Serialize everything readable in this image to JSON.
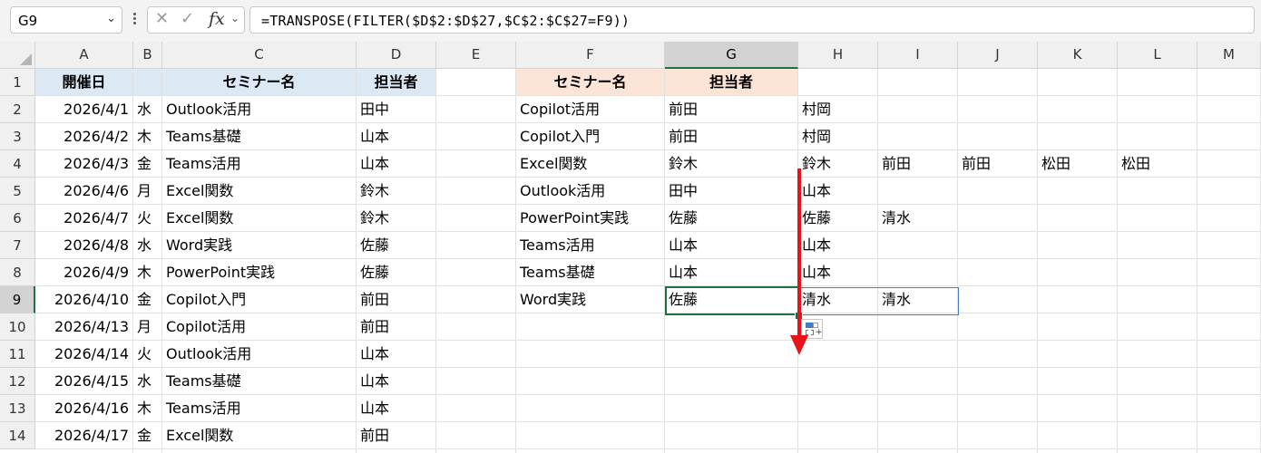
{
  "name_box": {
    "value": "G9"
  },
  "formula_bar": {
    "formula": "=TRANSPOSE(FILTER($D$2:$D$27,$C$2:$C$27=F9))",
    "cancel_icon": "close-icon",
    "enter_icon": "checkmark-icon",
    "function_icon": "fx"
  },
  "columns": [
    "A",
    "B",
    "C",
    "D",
    "E",
    "F",
    "G",
    "H",
    "I",
    "J",
    "K",
    "L",
    "M"
  ],
  "selected_column": "G",
  "selected_row": "9",
  "rows": [
    "1",
    "2",
    "3",
    "4",
    "5",
    "6",
    "7",
    "8",
    "9",
    "10",
    "11",
    "12",
    "13",
    "14"
  ],
  "table1": {
    "headers": {
      "date": "開催日",
      "seminar": "セミナー名",
      "person": "担当者"
    },
    "rows": [
      {
        "date": "2026/4/1",
        "dow": "水",
        "seminar": "Outlook活用",
        "person": "田中"
      },
      {
        "date": "2026/4/2",
        "dow": "木",
        "seminar": "Teams基礎",
        "person": "山本"
      },
      {
        "date": "2026/4/3",
        "dow": "金",
        "seminar": "Teams活用",
        "person": "山本"
      },
      {
        "date": "2026/4/6",
        "dow": "月",
        "seminar": "Excel関数",
        "person": "鈴木"
      },
      {
        "date": "2026/4/7",
        "dow": "火",
        "seminar": "Excel関数",
        "person": "鈴木"
      },
      {
        "date": "2026/4/8",
        "dow": "水",
        "seminar": "Word実践",
        "person": "佐藤"
      },
      {
        "date": "2026/4/9",
        "dow": "木",
        "seminar": "PowerPoint実践",
        "person": "佐藤"
      },
      {
        "date": "2026/4/10",
        "dow": "金",
        "seminar": "Copilot入門",
        "person": "前田"
      },
      {
        "date": "2026/4/13",
        "dow": "月",
        "seminar": "Copilot活用",
        "person": "前田"
      },
      {
        "date": "2026/4/14",
        "dow": "火",
        "seminar": "Outlook活用",
        "person": "山本"
      },
      {
        "date": "2026/4/15",
        "dow": "水",
        "seminar": "Teams基礎",
        "person": "山本"
      },
      {
        "date": "2026/4/16",
        "dow": "木",
        "seminar": "Teams活用",
        "person": "山本"
      },
      {
        "date": "2026/4/17",
        "dow": "金",
        "seminar": "Excel関数",
        "person": "前田"
      }
    ]
  },
  "table2": {
    "headers": {
      "seminar": "セミナー名",
      "person": "担当者"
    },
    "rows": [
      {
        "seminar": "Copilot活用",
        "person": "前田",
        "spill": [
          "村岡"
        ]
      },
      {
        "seminar": "Copilot入門",
        "person": "前田",
        "spill": [
          "村岡"
        ]
      },
      {
        "seminar": "Excel関数",
        "person": "鈴木",
        "spill": [
          "鈴木",
          "前田",
          "前田",
          "松田",
          "松田"
        ]
      },
      {
        "seminar": "Outlook活用",
        "person": "田中",
        "spill": [
          "山本"
        ]
      },
      {
        "seminar": "PowerPoint実践",
        "person": "佐藤",
        "spill": [
          "佐藤",
          "清水"
        ]
      },
      {
        "seminar": "Teams活用",
        "person": "山本",
        "spill": [
          "山本"
        ]
      },
      {
        "seminar": "Teams基礎",
        "person": "山本",
        "spill": [
          "山本"
        ]
      },
      {
        "seminar": "Word実践",
        "person": "佐藤",
        "spill": [
          "清水",
          "清水"
        ]
      }
    ]
  },
  "colors": {
    "table1_header_bg": "#dde8f5",
    "table2_header_bg": "#fce4d6",
    "active_cell_border": "#1e7145",
    "spill_border": "#3d7dc9",
    "arrow": "#e8121b"
  }
}
